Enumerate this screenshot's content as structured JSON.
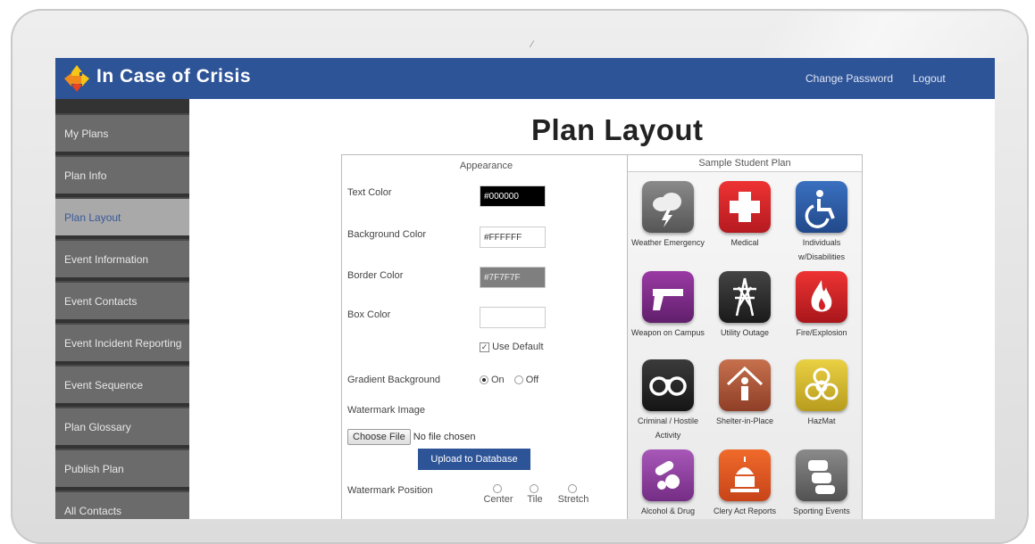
{
  "app": {
    "title": "In Case of Crisis"
  },
  "header": {
    "change_password": "Change Password",
    "logout": "Logout"
  },
  "sidebar": {
    "items": [
      {
        "label": "My Plans"
      },
      {
        "label": "Plan Info"
      },
      {
        "label": "Plan Layout",
        "active": true
      },
      {
        "label": "Event Information"
      },
      {
        "label": "Event Contacts"
      },
      {
        "label": "Event Incident Reporting"
      },
      {
        "label": "Event Sequence"
      },
      {
        "label": "Plan Glossary"
      },
      {
        "label": "Publish Plan"
      },
      {
        "label": "All Contacts"
      }
    ]
  },
  "page": {
    "title": "Plan Layout"
  },
  "appearance": {
    "title": "Appearance",
    "text_color": {
      "label": "Text Color",
      "value": "#000000",
      "swatch": "#000000"
    },
    "background_color": {
      "label": "Background Color",
      "value": "#FFFFFF",
      "swatch": "#FFFFFF"
    },
    "border_color": {
      "label": "Border Color",
      "value": "#7F7F7F",
      "swatch": "#7F7F7F"
    },
    "box_color": {
      "label": "Box Color",
      "value": ""
    },
    "use_default": {
      "label": "Use Default",
      "checked": true
    },
    "gradient": {
      "label": "Gradient Background",
      "on": "On",
      "off": "Off",
      "selected": "On"
    },
    "watermark_image": {
      "label": "Watermark Image",
      "choose_file": "Choose File",
      "no_file": "No file chosen",
      "upload": "Upload to Database"
    },
    "watermark_position": {
      "label": "Watermark Position",
      "options": [
        "Center",
        "Tile",
        "Stretch"
      ]
    }
  },
  "sample": {
    "title": "Sample Student Plan",
    "tiles": [
      {
        "label": "Weather Emergency",
        "icon": "storm-cloud-icon",
        "color": "#6b6b6b"
      },
      {
        "label": "Medical",
        "icon": "medical-cross-icon",
        "color": "#d32027"
      },
      {
        "label": "Individuals w/Disabilities",
        "icon": "wheelchair-icon",
        "color": "#2c5ea8"
      },
      {
        "label": "Weapon on Campus",
        "icon": "gun-icon",
        "color": "#7a2a82"
      },
      {
        "label": "Utility Outage",
        "icon": "power-tower-icon",
        "color": "#2a2a2a"
      },
      {
        "label": "Fire/Explosion",
        "icon": "flame-icon",
        "color": "#d32027"
      },
      {
        "label": "Criminal / Hostile Activity",
        "icon": "handcuffs-icon",
        "color": "#2a2a2a"
      },
      {
        "label": "Shelter-in-Place",
        "icon": "shelter-icon",
        "color": "#b4593a"
      },
      {
        "label": "HazMat",
        "icon": "biohazard-icon",
        "color": "#d7bd2d"
      },
      {
        "label": "Alcohol & Drug",
        "icon": "pills-icon",
        "color": "#8e3fa0"
      },
      {
        "label": "Clery Act Reports",
        "icon": "capitol-icon",
        "color": "#e2571e"
      },
      {
        "label": "Sporting Events",
        "icon": "cars-icon",
        "color": "#6b6b6b"
      }
    ]
  }
}
